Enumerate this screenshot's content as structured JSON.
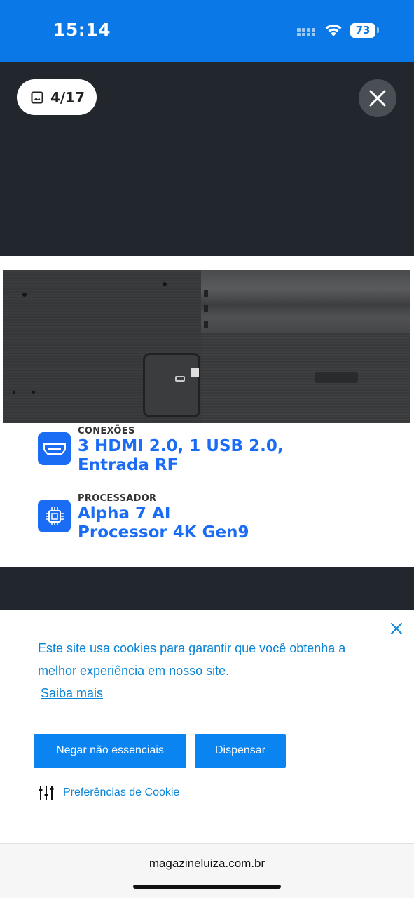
{
  "status_bar": {
    "time": "15:14",
    "battery": "73",
    "wifi_icon": "wifi-icon",
    "signal_icon": "cellular-signal-icon"
  },
  "viewer": {
    "counter": "4/17",
    "counter_icon": "image-icon",
    "close_icon": "close-icon",
    "features": [
      {
        "label": "CONEXÕES",
        "value_line1": "3 HDMI 2.0, 1 USB 2.0,",
        "value_line2": "Entrada RF",
        "icon": "hdmi-icon"
      },
      {
        "label": "PROCESSADOR",
        "value_line1": "Alpha 7 AI",
        "value_line2": "Processor 4K Gen9",
        "icon": "processor-chip-icon"
      }
    ]
  },
  "cookie_banner": {
    "text": "Este site usa cookies para garantir que você obtenha a melhor experiência em nosso site.",
    "learn_more": "Saiba mais",
    "deny_button": "Negar não essenciais",
    "dismiss_button": "Dispensar",
    "preferences": "Preferências de Cookie",
    "preferences_icon": "sliders-icon",
    "close_icon": "close-icon"
  },
  "browser": {
    "url": "magazineluiza.com.br"
  },
  "colors": {
    "status_bar": "#0a78e6",
    "viewer_bg": "#22262d",
    "feature_blue": "#1a6cf5",
    "cookie_button": "#0a84f0",
    "cookie_text": "#0a84d6"
  }
}
